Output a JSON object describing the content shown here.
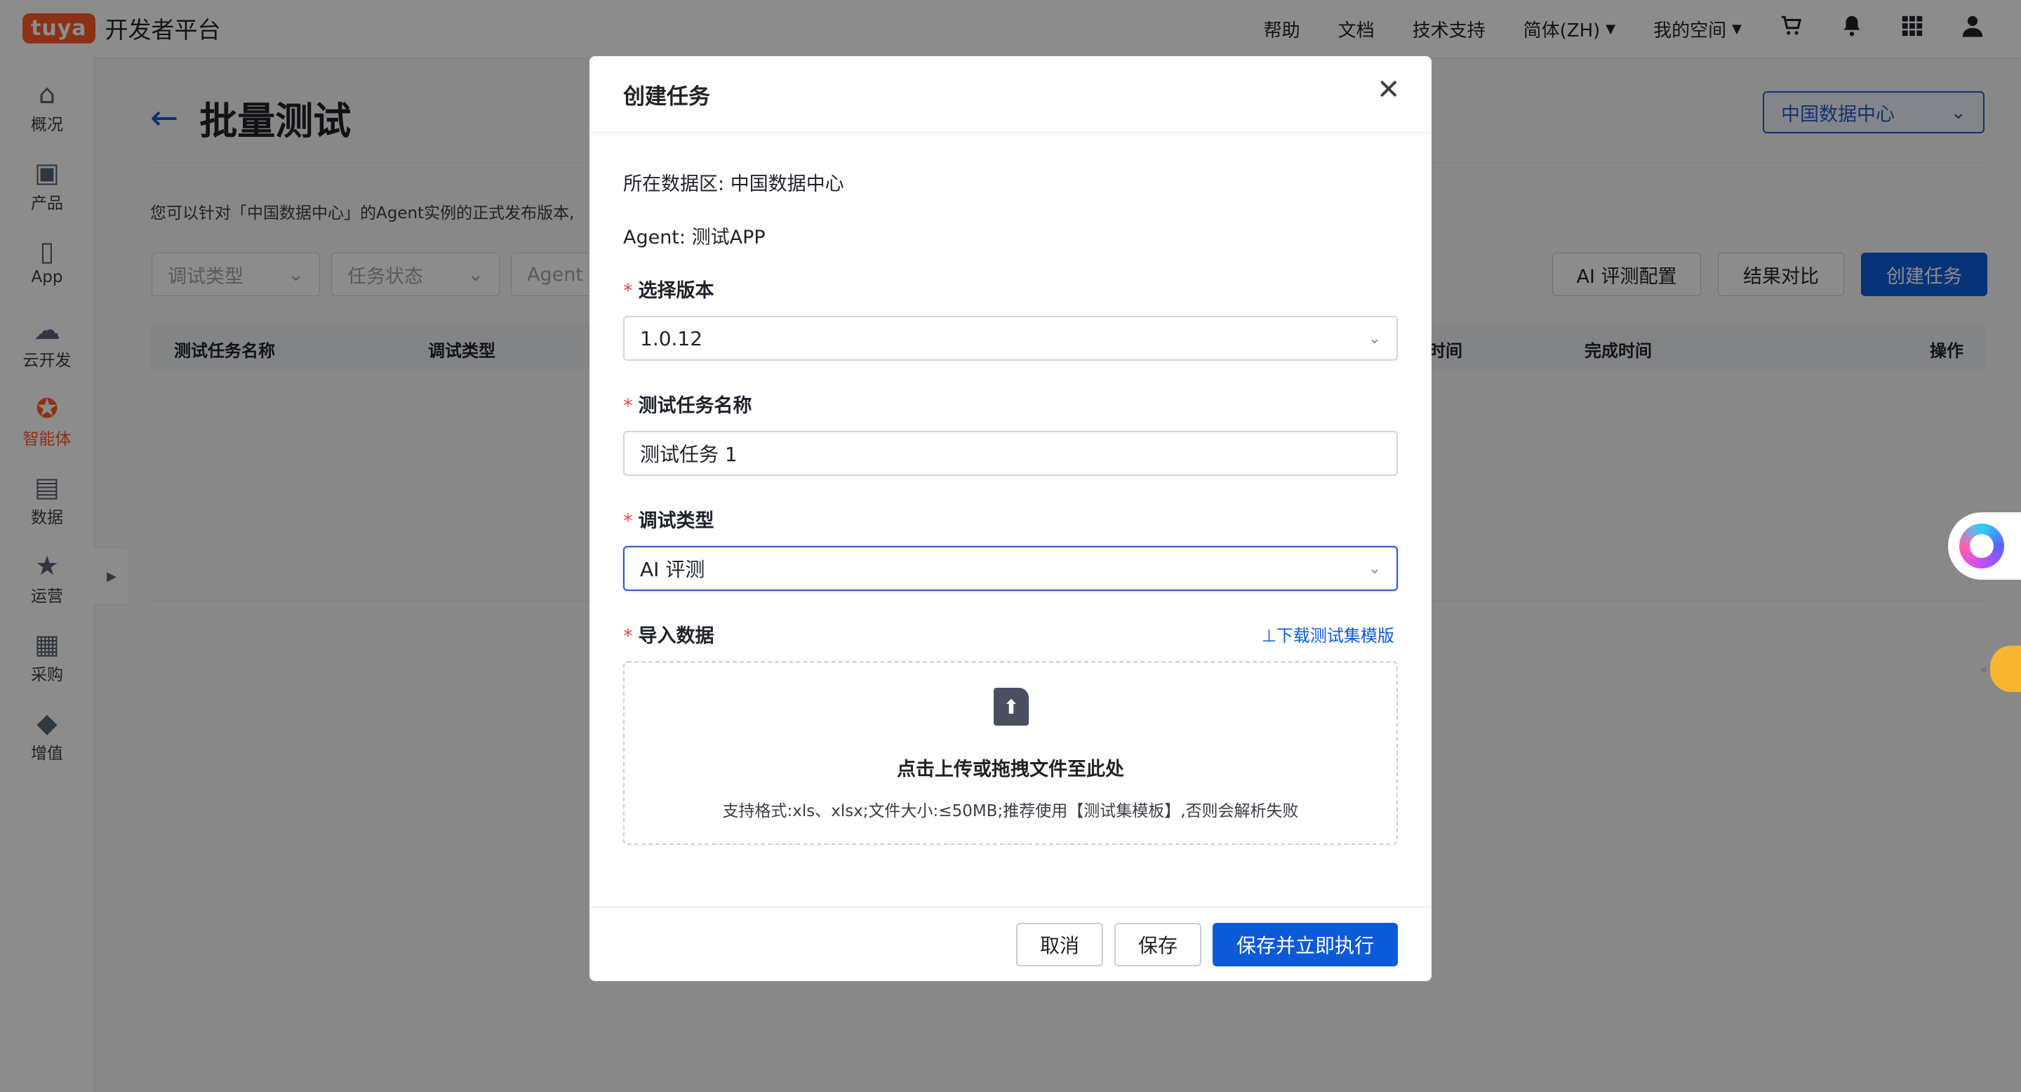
{
  "colors": {
    "brand": "#ff5a28",
    "primary": "#0b5bd9",
    "required": "#f53f3f"
  },
  "topbar": {
    "logo_badge": "tuya",
    "logo_text": "开发者平台",
    "nav": {
      "help": "帮助",
      "docs": "文档",
      "support": "技术支持",
      "language": "简体(ZH)",
      "my_space": "我的空间"
    },
    "icons": [
      "cart-icon",
      "bell-icon",
      "apps-grid-icon",
      "user-icon"
    ]
  },
  "sidebar": {
    "items": [
      {
        "label": "概况",
        "icon": "home-icon"
      },
      {
        "label": "产品",
        "icon": "terminal-icon"
      },
      {
        "label": "App",
        "icon": "phone-icon"
      },
      {
        "label": "云开发",
        "icon": "cloud-icon"
      },
      {
        "label": "智能体",
        "icon": "agent-icon",
        "active": true
      },
      {
        "label": "数据",
        "icon": "chart-icon"
      },
      {
        "label": "运营",
        "icon": "bookmark-icon"
      },
      {
        "label": "采购",
        "icon": "box-icon"
      },
      {
        "label": "增值",
        "icon": "diamond-icon"
      }
    ]
  },
  "page": {
    "title": "批量测试",
    "region": "中国数据中心",
    "description": "您可以针对「中国数据中心」的Agent实例的正式发布版本,",
    "filters": {
      "debug_type": "调试类型",
      "task_status": "任务状态",
      "agent": "Agent"
    },
    "buttons": {
      "ai_eval_config": "AI 评测配置",
      "result_compare": "结果对比",
      "create_task": "创建任务"
    },
    "table": {
      "headers": {
        "name": "测试任务名称",
        "type": "调试类型",
        "time": "时间",
        "done_time": "完成时间",
        "ops": "操作"
      }
    }
  },
  "modal": {
    "title": "创建任务",
    "region_label": "所在数据区:",
    "region_value": "中国数据中心",
    "agent_label": "Agent:",
    "agent_value": "测试APP",
    "version_label": "选择版本",
    "version_value": "1.0.12",
    "task_name_label": "测试任务名称",
    "task_name_value": "测试任务 1",
    "debug_type_label": "调试类型",
    "debug_type_value": "AI 评测",
    "import_label": "导入数据",
    "download_template": "⊥下载测试集模版",
    "upload_title": "点击上传或拖拽文件至此处",
    "upload_hint": "支持格式:xls、xlsx;文件大小:≤50MB;推荐使用【测试集模板】,否则会解析失败",
    "cancel": "取消",
    "save": "保存",
    "save_and_run": "保存并立即执行"
  }
}
